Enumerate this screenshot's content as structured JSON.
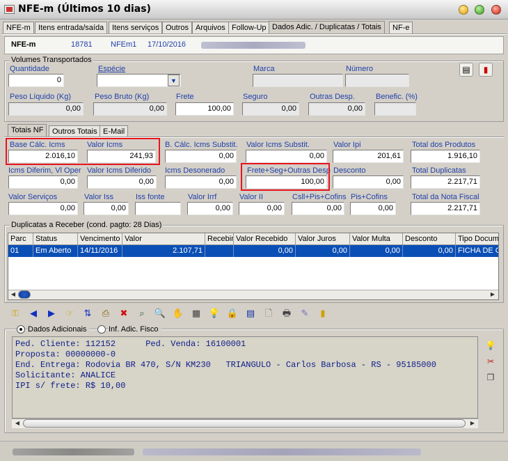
{
  "window": {
    "title": "NFE-m (Últimos 10 dias)"
  },
  "main_tabs": [
    "NFE-m",
    "Itens entrada/saída",
    "Itens serviços",
    "Outros",
    "Arquivos",
    "Follow-Up",
    "Dados Adic. / Duplicatas / Totais",
    "NF-e"
  ],
  "header": {
    "label": "NFE-m",
    "number": "18781",
    "series": "NFEm1",
    "date": "17/10/2016"
  },
  "volumes": {
    "title": "Volumes Transportados",
    "quantidade_label": "Quantidade",
    "quantidade": "0",
    "especie_label": "Espécie",
    "especie": "",
    "marca_label": "Marca",
    "marca": "",
    "numero_label": "Número",
    "numero": "",
    "peso_liquido_label": "Peso Líquido (Kg)",
    "peso_liquido": "0,00",
    "peso_bruto_label": "Peso Bruto (Kg)",
    "peso_bruto": "0,00",
    "frete_label": "Frete",
    "frete": "100,00",
    "seguro_label": "Seguro",
    "seguro": "0,00",
    "outras_desp_label": "Outras Desp.",
    "outras_desp": "0,00",
    "benefic_label": "Benefic. (%)",
    "benefic": ""
  },
  "sub_tabs": [
    "Totais NF",
    "Outros Totais",
    "E-Mail"
  ],
  "totais": {
    "base_icms_label": "Base Cálc. Icms",
    "base_icms": "2.016,10",
    "valor_icms_label": "Valor Icms",
    "valor_icms": "241,93",
    "base_icms_subst_label": "B. Cálc. Icms Substit.",
    "base_icms_subst": "0,00",
    "valor_icms_subst_label": "Valor Icms Substit.",
    "valor_icms_subst": "0,00",
    "valor_ipi_label": "Valor Ipi",
    "valor_ipi": "201,61",
    "total_produtos_label": "Total dos Produtos",
    "total_produtos": "1.916,10",
    "icms_diferim_label": "Icms Diferim, Vl Oper",
    "icms_diferim": "0,00",
    "valor_icms_diferido_label": "Valor Icms Diferido",
    "valor_icms_diferido": "0,00",
    "icms_desonerado_label": "Icms Desonerado",
    "icms_desonerado": "0,00",
    "frete_seg_label": "Frete+Seg+Outras Desp",
    "frete_seg": "100,00",
    "desconto_label": "Desconto",
    "desconto": "0,00",
    "total_duplicatas_label": "Total Duplicatas",
    "total_duplicatas": "2.217,71",
    "valor_servicos_label": "Valor Serviços",
    "valor_servicos": "0,00",
    "valor_iss_label": "Valor Iss",
    "valor_iss": "0,00",
    "iss_fonte_label": "Iss fonte",
    "iss_fonte": "",
    "valor_irrf_label": "Valor Irrf",
    "valor_irrf": "0,00",
    "valor_ii_label": "Valor II",
    "valor_ii": "0,00",
    "csll_label": "Csll+Pis+Cofins",
    "csll": "0,00",
    "pis_cofins_label": "Pis+Cofins",
    "pis_cofins": "0,00",
    "total_nota_label": "Total da Nota Fiscal",
    "total_nota": "2.217,71"
  },
  "duplicatas": {
    "title": "Duplicatas a Receber (cond. pagto: 28 Dias)",
    "columns": [
      "Parc",
      "Status",
      "Vencimento",
      "Valor",
      "Recebimento",
      "Valor Recebido",
      "Valor Juros",
      "Valor Multa",
      "Desconto",
      "Tipo Docum"
    ],
    "rows": [
      [
        "01",
        "Em Aberto",
        "14/11/2016",
        "2.107,71",
        "",
        "0,00",
        "0,00",
        "0,00",
        "0,00",
        "FICHA DE C"
      ]
    ]
  },
  "toolbar_icons": [
    "key-icon",
    "prev-icon",
    "next-icon",
    "hand-pointer-icon",
    "sort-icon",
    "printer-icon",
    "delete-icon",
    "search-doc-icon",
    "zoom-icon",
    "hand-icon",
    "calculator-icon",
    "lightbulb-icon",
    "lock-icon",
    "table-icon",
    "new-doc-icon",
    "print-icon",
    "edit-icon",
    "exit-icon"
  ],
  "adicionais": {
    "radio_dados": "Dados Adicionais",
    "radio_fisco": "Inf. Adic. Fisco",
    "text": "Ped. Cliente: 112152      Ped. Venda: 16100001\nProposta: 00000000-0\nEnd. Entrega: Rodovia BR 470, S/N KM230   TRIANGULO - Carlos Barbosa - RS - 95185000\nSolicitante: ANALICE\nIPI s/ frete: R$ 10,00"
  },
  "colors": {
    "highlight_red": "#e8141e",
    "selection_blue": "#0a4fb5",
    "label_blue": "#1f3fa8"
  }
}
